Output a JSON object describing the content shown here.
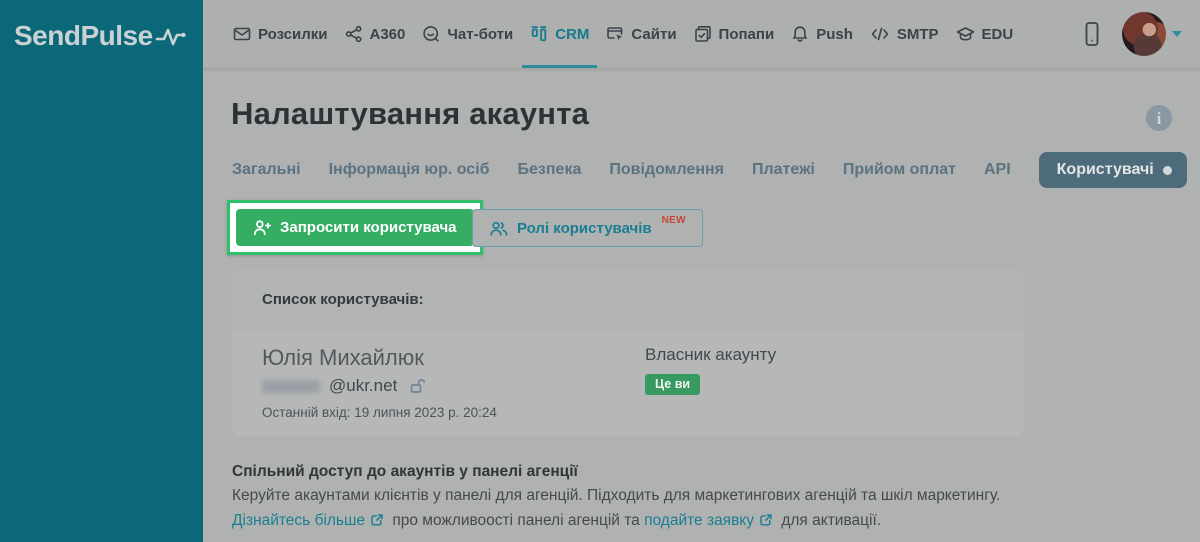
{
  "colors": {
    "brand_teal": "#0b6879",
    "active_nav_teal": "#167b8d",
    "highlight_green": "#35ae63",
    "highlight_border_green": "#2ec06a",
    "badge_green": "#389a61",
    "new_badge_red": "#c6473a",
    "link_teal": "#1a7e92",
    "selected_tab_bg": "#4d6b7a"
  },
  "sidebar": {
    "logo_text": "SendPulse",
    "logo_icon": "pulse-icon"
  },
  "navbar": {
    "items": [
      {
        "label": "Розсилки",
        "icon": "envelope-icon",
        "active": false
      },
      {
        "label": "A360",
        "icon": "share-nodes-icon",
        "active": false
      },
      {
        "label": "Чат-боти",
        "icon": "chat-icon",
        "active": false
      },
      {
        "label": "CRM",
        "icon": "kanban-icon",
        "active": true
      },
      {
        "label": "Сайти",
        "icon": "browser-cursor-icon",
        "active": false
      },
      {
        "label": "Попапи",
        "icon": "popup-check-icon",
        "active": false
      },
      {
        "label": "Push",
        "icon": "bell-icon",
        "active": false
      },
      {
        "label": "SMTP",
        "icon": "code-icon",
        "active": false
      },
      {
        "label": "EDU",
        "icon": "graduation-cap-icon",
        "active": false
      }
    ],
    "right": {
      "phone_icon": "mobile-icon",
      "avatar": "user-avatar-photo",
      "caret_icon": "chevron-down-icon"
    }
  },
  "header": {
    "title": "Налаштування акаунта",
    "info_icon": "info-icon"
  },
  "tabs": {
    "items": [
      {
        "label": "Загальні",
        "selected": false
      },
      {
        "label": "Інформація юр. осіб",
        "selected": false
      },
      {
        "label": "Безпека",
        "selected": false
      },
      {
        "label": "Повідомлення",
        "selected": false
      },
      {
        "label": "Платежі",
        "selected": false
      },
      {
        "label": "Прийом оплат",
        "selected": false
      },
      {
        "label": "API",
        "selected": false
      },
      {
        "label": "Користувачі",
        "selected": true,
        "has_indicator_dot": true
      }
    ]
  },
  "actions": {
    "invite_button": {
      "label": "Запросити користувача",
      "icon": "user-plus-icon",
      "highlighted": true
    },
    "roles_button": {
      "label": "Ролі користувачів",
      "icon": "users-icon",
      "badge": "NEW"
    }
  },
  "user_list": {
    "title": "Список користувачів:",
    "rows": [
      {
        "name": "Юлія Михайлюк",
        "email_visible_part": "@ukr.net",
        "email_masked": true,
        "lock_icon": "unlock-icon",
        "last_login": "Останній вхід: 19 липня 2023 р. 20:24",
        "role": "Власник акаунту",
        "badge": "Це ви"
      }
    ]
  },
  "agency_section": {
    "title": "Спільний доступ до акаунтів у панелі агенції",
    "description": "Керуйте акаунтами клієнтів у панелі для агенцій. Підходить для маркетингових агенцій та шкіл маркетингу.",
    "link1": "Дізнайтесь більше",
    "middle_text": " про можливоості панелі агенцій та ",
    "link2": "подайте заявку",
    "end_text": " для активації.",
    "external_link_icon": "external-link-icon"
  }
}
